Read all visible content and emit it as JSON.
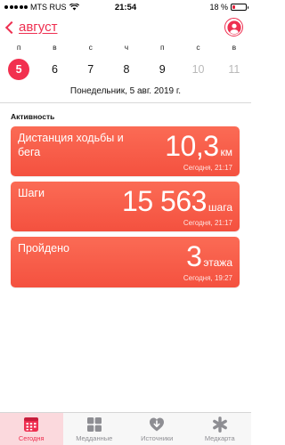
{
  "status_bar": {
    "carrier": "MTS RUS",
    "time": "21:54",
    "battery_percent": "18 %",
    "battery_level": 0.18
  },
  "nav": {
    "back_label": "август"
  },
  "calendar": {
    "weekdays": [
      "п",
      "в",
      "с",
      "ч",
      "п",
      "с",
      "в"
    ],
    "dates": [
      "5",
      "6",
      "7",
      "8",
      "9",
      "10",
      "11"
    ],
    "selected_index": 0,
    "full_date": "Понедельник, 5 авг. 2019 г."
  },
  "activity": {
    "section_title": "Активность",
    "cards": [
      {
        "title": "Дистанция ходьбы и бега",
        "value": "10,3",
        "unit": "км",
        "timestamp": "Сегодня, 21:17"
      },
      {
        "title": "Шаги",
        "value": "15 563",
        "unit": "шага",
        "timestamp": "Сегодня, 21:17"
      },
      {
        "title": "Пройдено",
        "value": "3",
        "unit": "этажа",
        "timestamp": "Сегодня, 19:27"
      }
    ]
  },
  "tabbar": {
    "tabs": [
      {
        "label": "Сегодня",
        "icon": "calendar-icon",
        "active": true
      },
      {
        "label": "Медданные",
        "icon": "grid-icon",
        "active": false
      },
      {
        "label": "Источники",
        "icon": "heart-download-icon",
        "active": false
      },
      {
        "label": "Медкарта",
        "icon": "asterisk-icon",
        "active": false
      }
    ]
  },
  "colors": {
    "accent": "#ee2f50",
    "card_top": "#fb6b55",
    "card_bottom": "#f4513f"
  }
}
